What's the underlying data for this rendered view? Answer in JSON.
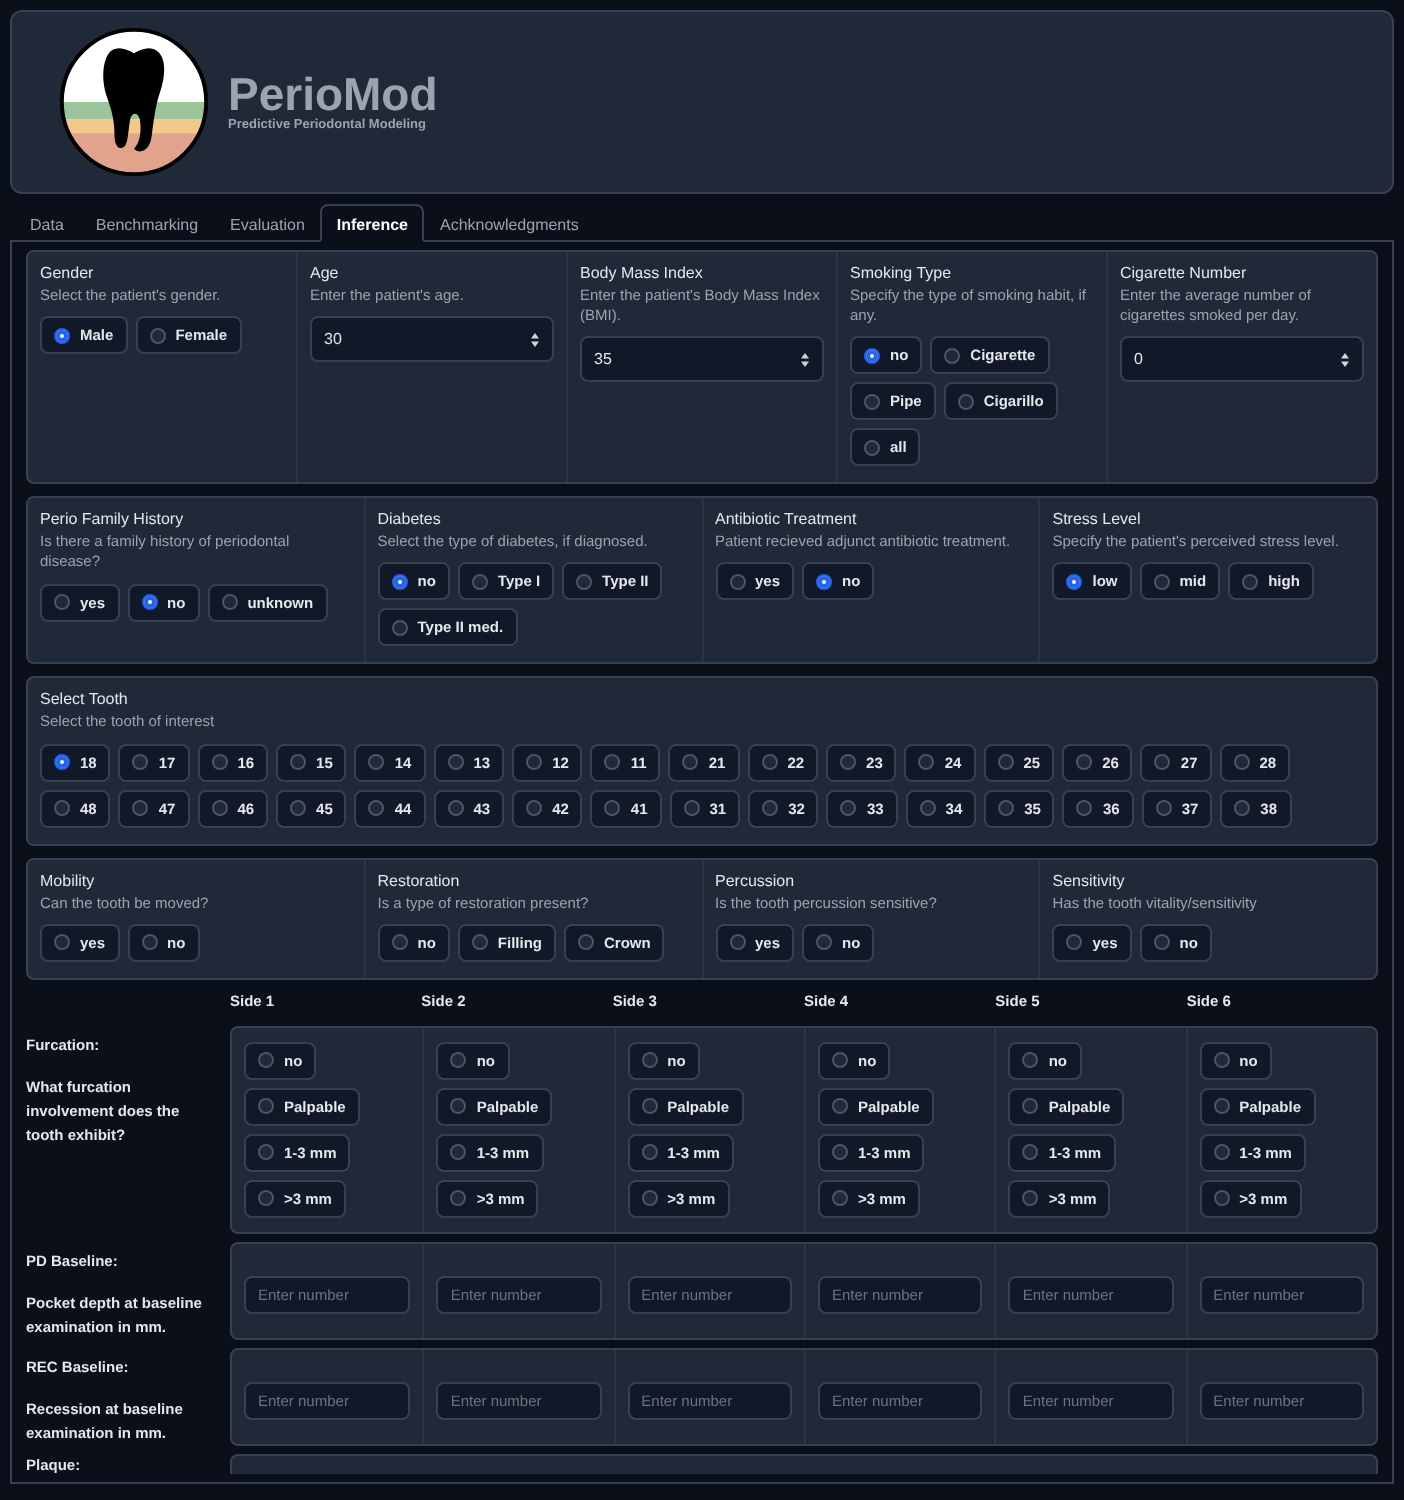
{
  "header": {
    "title": "PerioMod",
    "subtitle": "Predictive Periodontal Modeling"
  },
  "tabs": [
    {
      "label": "Data",
      "selected": false
    },
    {
      "label": "Benchmarking",
      "selected": false
    },
    {
      "label": "Evaluation",
      "selected": false
    },
    {
      "label": "Inference",
      "selected": true
    },
    {
      "label": "Achknowledgments",
      "selected": false
    }
  ],
  "groups": [
    {
      "fields": [
        {
          "kind": "radio",
          "label": "Gender",
          "description": "Select the patient's gender.",
          "options": [
            {
              "label": "Male",
              "selected": true
            },
            {
              "label": "Female",
              "selected": false
            }
          ]
        },
        {
          "kind": "number",
          "label": "Age",
          "description": "Enter the patient's age.",
          "value": "30"
        },
        {
          "kind": "number",
          "label": "Body Mass Index",
          "description": "Enter the patient's Body Mass Index (BMI).",
          "value": "35"
        },
        {
          "kind": "radio",
          "label": "Smoking Type",
          "description": "Specify the type of smoking habit, if any.",
          "options": [
            {
              "label": "no",
              "selected": true
            },
            {
              "label": "Cigarette",
              "selected": false
            },
            {
              "label": "Pipe",
              "selected": false
            },
            {
              "label": "Cigarillo",
              "selected": false
            },
            {
              "label": "all",
              "selected": false
            }
          ]
        },
        {
          "kind": "number",
          "label": "Cigarette Number",
          "description": "Enter the average number of cigarettes smoked per day.",
          "value": "0"
        }
      ]
    },
    {
      "fields": [
        {
          "kind": "radio",
          "label": "Perio Family History",
          "description": "Is there a family history of periodontal disease?",
          "options": [
            {
              "label": "yes",
              "selected": false
            },
            {
              "label": "no",
              "selected": true
            },
            {
              "label": "unknown",
              "selected": false
            }
          ]
        },
        {
          "kind": "radio",
          "label": "Diabetes",
          "description": "Select the type of diabetes, if diagnosed.",
          "options": [
            {
              "label": "no",
              "selected": true
            },
            {
              "label": "Type I",
              "selected": false
            },
            {
              "label": "Type II",
              "selected": false
            },
            {
              "label": "Type II med.",
              "selected": false
            }
          ]
        },
        {
          "kind": "radio",
          "label": "Antibiotic Treatment",
          "description": "Patient recieved adjunct antibiotic treatment.",
          "options": [
            {
              "label": "yes",
              "selected": false
            },
            {
              "label": "no",
              "selected": true
            }
          ]
        },
        {
          "kind": "radio",
          "label": "Stress Level",
          "description": "Specify the patient's perceived stress level.",
          "options": [
            {
              "label": "low",
              "selected": true
            },
            {
              "label": "mid",
              "selected": false
            },
            {
              "label": "high",
              "selected": false
            }
          ]
        }
      ]
    },
    {
      "fields": [
        {
          "kind": "radio",
          "label": "Select Tooth",
          "description": "Select the tooth of interest",
          "options": [
            {
              "label": "18",
              "selected": true
            },
            {
              "label": "17",
              "selected": false
            },
            {
              "label": "16",
              "selected": false
            },
            {
              "label": "15",
              "selected": false
            },
            {
              "label": "14",
              "selected": false
            },
            {
              "label": "13",
              "selected": false
            },
            {
              "label": "12",
              "selected": false
            },
            {
              "label": "11",
              "selected": false
            },
            {
              "label": "21",
              "selected": false
            },
            {
              "label": "22",
              "selected": false
            },
            {
              "label": "23",
              "selected": false
            },
            {
              "label": "24",
              "selected": false
            },
            {
              "label": "25",
              "selected": false
            },
            {
              "label": "26",
              "selected": false
            },
            {
              "label": "27",
              "selected": false
            },
            {
              "label": "28",
              "selected": false
            },
            {
              "label": "48",
              "selected": false
            },
            {
              "label": "47",
              "selected": false
            },
            {
              "label": "46",
              "selected": false
            },
            {
              "label": "45",
              "selected": false
            },
            {
              "label": "44",
              "selected": false
            },
            {
              "label": "43",
              "selected": false
            },
            {
              "label": "42",
              "selected": false
            },
            {
              "label": "41",
              "selected": false
            },
            {
              "label": "31",
              "selected": false
            },
            {
              "label": "32",
              "selected": false
            },
            {
              "label": "33",
              "selected": false
            },
            {
              "label": "34",
              "selected": false
            },
            {
              "label": "35",
              "selected": false
            },
            {
              "label": "36",
              "selected": false
            },
            {
              "label": "37",
              "selected": false
            },
            {
              "label": "38",
              "selected": false
            }
          ]
        }
      ]
    },
    {
      "fields": [
        {
          "kind": "radio",
          "label": "Mobility",
          "description": "Can the tooth be moved?",
          "options": [
            {
              "label": "yes",
              "selected": false
            },
            {
              "label": "no",
              "selected": false
            }
          ]
        },
        {
          "kind": "radio",
          "label": "Restoration",
          "description": "Is a type of restoration present?",
          "options": [
            {
              "label": "no",
              "selected": false
            },
            {
              "label": "Filling",
              "selected": false
            },
            {
              "label": "Crown",
              "selected": false
            }
          ]
        },
        {
          "kind": "radio",
          "label": "Percussion",
          "description": "Is the tooth percussion sensitive?",
          "options": [
            {
              "label": "yes",
              "selected": false
            },
            {
              "label": "no",
              "selected": false
            }
          ]
        },
        {
          "kind": "radio",
          "label": "Sensitivity",
          "description": "Has the tooth vitality/sensitivity",
          "options": [
            {
              "label": "yes",
              "selected": false
            },
            {
              "label": "no",
              "selected": false
            }
          ]
        }
      ]
    }
  ],
  "sides": {
    "headers": [
      "Side 1",
      "Side 2",
      "Side 3",
      "Side 4",
      "Side 5",
      "Side 6"
    ],
    "rows": [
      {
        "kind": "radio",
        "title": "Furcation:",
        "description": "What furcation involvement does the tooth exhibit?",
        "cells": [
          {
            "options": [
              {
                "label": "no",
                "selected": false
              },
              {
                "label": "Palpable",
                "selected": false
              },
              {
                "label": "1-3 mm",
                "selected": false
              },
              {
                "label": ">3 mm",
                "selected": false
              }
            ]
          },
          {
            "options": [
              {
                "label": "no",
                "selected": false
              },
              {
                "label": "Palpable",
                "selected": false
              },
              {
                "label": "1-3 mm",
                "selected": false
              },
              {
                "label": ">3 mm",
                "selected": false
              }
            ]
          },
          {
            "options": [
              {
                "label": "no",
                "selected": false
              },
              {
                "label": "Palpable",
                "selected": false
              },
              {
                "label": "1-3 mm",
                "selected": false
              },
              {
                "label": ">3 mm",
                "selected": false
              }
            ]
          },
          {
            "options": [
              {
                "label": "no",
                "selected": false
              },
              {
                "label": "Palpable",
                "selected": false
              },
              {
                "label": "1-3 mm",
                "selected": false
              },
              {
                "label": ">3 mm",
                "selected": false
              }
            ]
          },
          {
            "options": [
              {
                "label": "no",
                "selected": false
              },
              {
                "label": "Palpable",
                "selected": false
              },
              {
                "label": "1-3 mm",
                "selected": false
              },
              {
                "label": ">3 mm",
                "selected": false
              }
            ]
          },
          {
            "options": [
              {
                "label": "no",
                "selected": false
              },
              {
                "label": "Palpable",
                "selected": false
              },
              {
                "label": "1-3 mm",
                "selected": false
              },
              {
                "label": ">3 mm",
                "selected": false
              }
            ]
          }
        ]
      },
      {
        "kind": "number",
        "title": "PD Baseline:",
        "description": "Pocket depth at baseline examination in mm.",
        "cells": [
          {
            "placeholder": "Enter number"
          },
          {
            "placeholder": "Enter number"
          },
          {
            "placeholder": "Enter number"
          },
          {
            "placeholder": "Enter number"
          },
          {
            "placeholder": "Enter number"
          },
          {
            "placeholder": "Enter number"
          }
        ]
      },
      {
        "kind": "number",
        "title": "REC Baseline:",
        "description": "Recession at baseline examination in mm.",
        "cells": [
          {
            "placeholder": "Enter number"
          },
          {
            "placeholder": "Enter number"
          },
          {
            "placeholder": "Enter number"
          },
          {
            "placeholder": "Enter number"
          },
          {
            "placeholder": "Enter number"
          },
          {
            "placeholder": "Enter number"
          }
        ]
      },
      {
        "kind": "cut",
        "title": "Plaque:"
      }
    ]
  }
}
